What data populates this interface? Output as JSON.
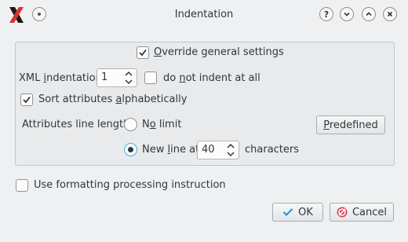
{
  "window": {
    "title": "Indentation",
    "app_icon": "x-logo-icon",
    "title_buttons": [
      "help-icon",
      "minimize-icon",
      "maximize-icon",
      "close-icon"
    ],
    "menu_button_icon": "window-menu-icon"
  },
  "override": {
    "checked": true,
    "label_mnemonic": "O",
    "label_rest": "verride general settings"
  },
  "xml_indentation": {
    "label_before": "XML ",
    "label_mnemonic": "i",
    "label_after": "ndentation",
    "value": "1"
  },
  "no_indent": {
    "checked": false,
    "label_before": "do ",
    "label_mnemonic": "n",
    "label_after": "ot indent at all"
  },
  "sort_attributes": {
    "checked": true,
    "label_before": "Sort attributes ",
    "label_mnemonic": "a",
    "label_after": "lphabetically"
  },
  "line_length": {
    "label": "Attributes line length:",
    "no_limit": {
      "selected": false,
      "label_before": "N",
      "label_mnemonic": "o",
      "label_after": " limit"
    },
    "new_line": {
      "selected": true,
      "label_before": "New ",
      "label_mnemonic": "l",
      "label_after": "ine at"
    },
    "value": "40",
    "unit": "characters"
  },
  "predefined_button": {
    "label_mnemonic": "P",
    "label_rest": "redefined"
  },
  "use_pi": {
    "checked": false,
    "label": "Use formatting processing instruction"
  },
  "buttons": {
    "ok": "OK",
    "cancel": "Cancel"
  },
  "colors": {
    "accent": "#3daee9",
    "window_bg": "#eff0f1",
    "cancel_icon": "#da4453"
  }
}
